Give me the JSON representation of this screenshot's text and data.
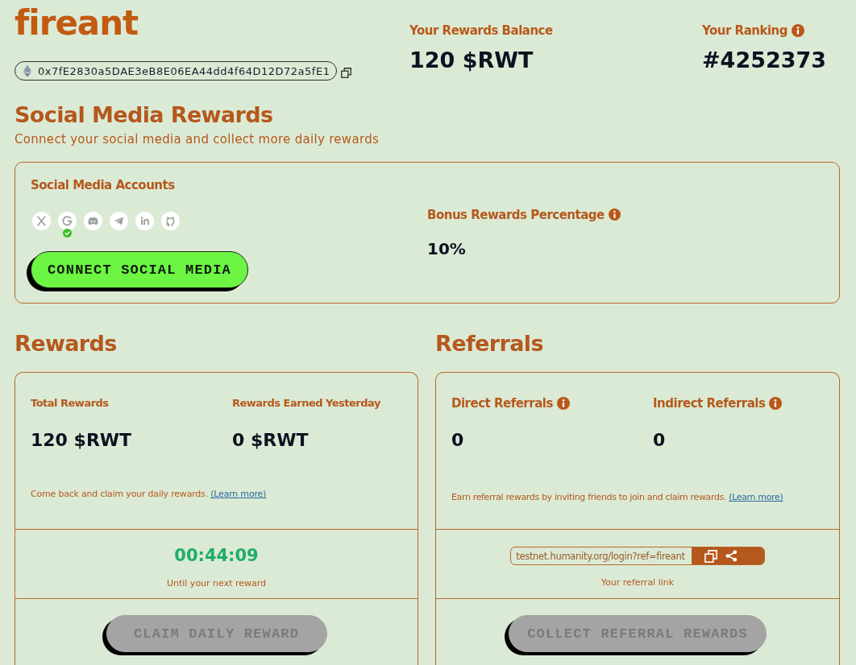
{
  "header": {
    "username": "fireant",
    "wallet_address": "0x7fE2830a5DAE3eB8E06EA44dd4f64D12D72a5fE1",
    "stats": [
      {
        "label": "Your Rewards Balance",
        "value": "120 $RWT",
        "info": false
      },
      {
        "label": "Your Ranking",
        "value": "#4252373",
        "info": true
      }
    ]
  },
  "social": {
    "title": "Social Media Rewards",
    "subtitle": "Connect your social media and collect more daily rewards",
    "accounts_label": "Social Media Accounts",
    "accounts": [
      {
        "kind": "x",
        "connected": false
      },
      {
        "kind": "google",
        "connected": true
      },
      {
        "kind": "discord",
        "connected": false
      },
      {
        "kind": "telegram",
        "connected": false
      },
      {
        "kind": "linkedin",
        "connected": false
      },
      {
        "kind": "github",
        "connected": false
      }
    ],
    "connect_button": {
      "label": "CONNECT SOCIAL MEDIA",
      "disabled": false
    },
    "bonus": {
      "label": "Bonus Rewards Percentage",
      "value": "10%",
      "info": true
    }
  },
  "rewards": {
    "title": "Rewards",
    "stats": [
      {
        "label": "Total Rewards",
        "value": "120 $RWT",
        "info": false
      },
      {
        "label": "Rewards Earned Yesterday",
        "value": "0 $RWT",
        "info": false
      }
    ],
    "note": "Come back and claim your daily rewards.",
    "learn_more": "(Learn more)",
    "timer": "00:44:09",
    "timer_caption": "Until your next reward",
    "button": {
      "label": "CLAIM DAILY REWARD",
      "disabled": true
    }
  },
  "referrals": {
    "title": "Referrals",
    "stats": [
      {
        "label": "Direct Referrals",
        "value": "0",
        "info": true
      },
      {
        "label": "Indirect Referrals",
        "value": "0",
        "info": true
      }
    ],
    "note": "Earn referral rewards by inviting friends to join and claim rewards.",
    "learn_more": "(Learn more)",
    "link": "testnet.humanity.org/login?ref=fireant",
    "link_caption": "Your referral link",
    "button": {
      "label": "COLLECT REFERRAL REWARDS",
      "disabled": true
    }
  }
}
